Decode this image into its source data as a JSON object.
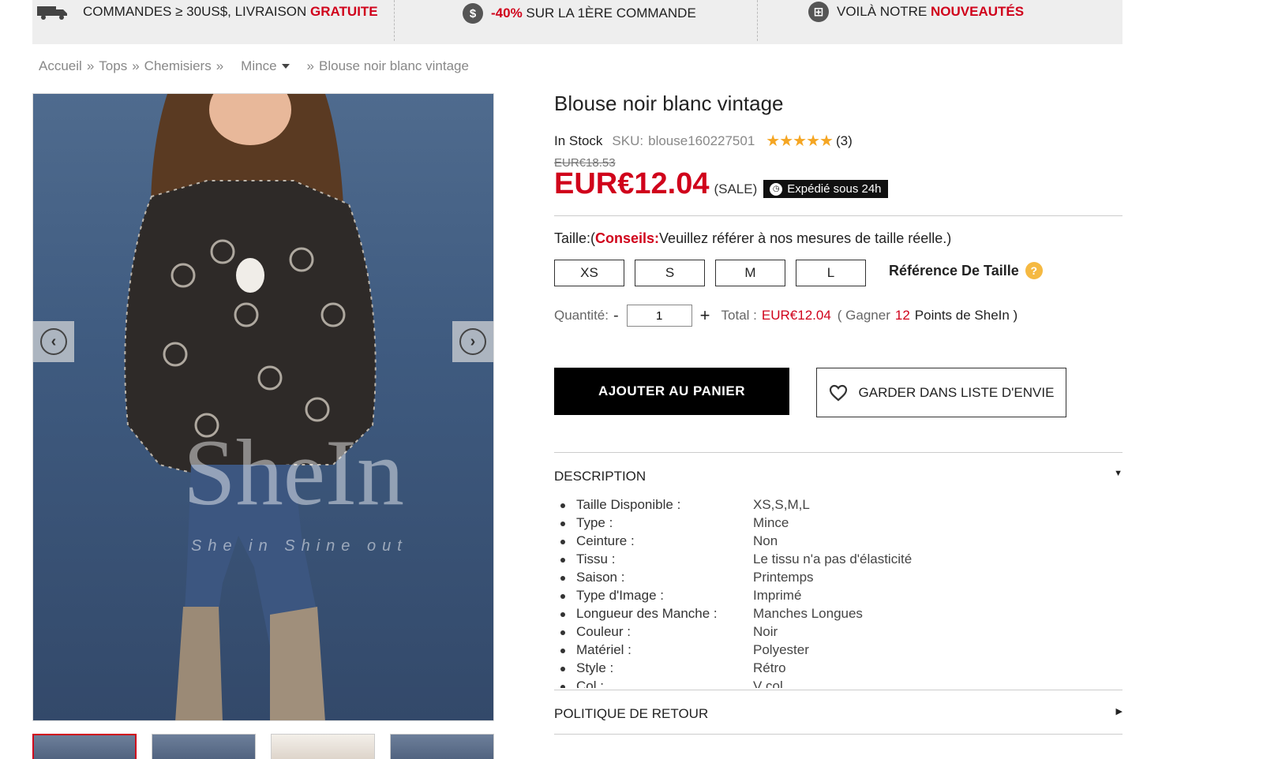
{
  "promo": {
    "item1_text": "COMMANDES ≥ 30US$, LIVRAISON ",
    "item1_highlight": "GRATUITE",
    "item2_highlight": "-40%",
    "item2_text": " SUR LA 1ÈRE COMMANDE",
    "item3_text": "VOILÀ NOTRE ",
    "item3_highlight": "NOUVEAUTÉS",
    "icon2_glyph": "$",
    "icon3_glyph": "⊞"
  },
  "breadcrumb": {
    "home": "Accueil",
    "sep": "»",
    "level1": "Tops",
    "level2": "Chemisiers",
    "level3": "Mince",
    "current": "Blouse noir blanc vintage"
  },
  "gallery": {
    "watermark": "SheIn",
    "watermark_sub": "She in Shine out",
    "prev_glyph": "‹",
    "next_glyph": "›"
  },
  "product": {
    "title": "Blouse noir blanc vintage",
    "stock": "In Stock",
    "sku_label": "SKU:",
    "sku": "blouse160227501",
    "stars": "★★★★★",
    "rating_count": "(3)",
    "old_price": "EUR€18.53",
    "price": "EUR€12.04",
    "sale_label": "(SALE)",
    "shipping_badge": "Expédié sous 24h"
  },
  "size": {
    "label": "Taille:(",
    "tip_label": "Conseils:",
    "tip_text": "Veuillez référer à nos mesures de taille réelle.)",
    "options": [
      "XS",
      "S",
      "M",
      "L"
    ],
    "reference_label": "Référence De Taille",
    "help_glyph": "?"
  },
  "quantity": {
    "label": "Quantité:",
    "minus": "-",
    "value": "1",
    "plus": "+",
    "total_label": "Total :",
    "total_value": "EUR€12.04",
    "points_open": "( Gagner",
    "points_value": "12",
    "points_close": "Points de SheIn )"
  },
  "actions": {
    "add_to_cart": "AJOUTER AU PANIER",
    "wishlist": "GARDER DANS LISTE D'ENVIE"
  },
  "description": {
    "heading": "DESCRIPTION",
    "toggle": "▼",
    "items": [
      {
        "key": "Taille Disponible :",
        "value": "XS,S,M,L"
      },
      {
        "key": "Type :",
        "value": "Mince"
      },
      {
        "key": "Ceinture :",
        "value": "Non"
      },
      {
        "key": "Tissu :",
        "value": "Le tissu n'a pas d'élasticité"
      },
      {
        "key": "Saison :",
        "value": "Printemps"
      },
      {
        "key": "Type d'Image :",
        "value": "Imprimé"
      },
      {
        "key": "Longueur des Manche :",
        "value": "Manches Longues"
      },
      {
        "key": "Couleur :",
        "value": "Noir"
      },
      {
        "key": "Matériel :",
        "value": "Polyester"
      },
      {
        "key": "Style :",
        "value": "Rétro"
      },
      {
        "key": "Col :",
        "value": "V col"
      }
    ]
  },
  "return_policy": {
    "heading": "POLITIQUE DE RETOUR",
    "toggle": "▶"
  },
  "colors": {
    "accent_red": "#d0021b",
    "star_orange": "#f5a623",
    "promo_bg": "#eeeeee"
  }
}
